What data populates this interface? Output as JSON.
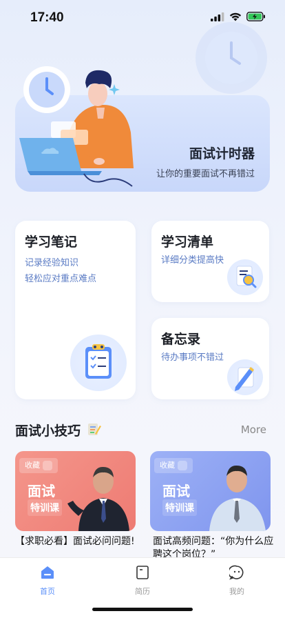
{
  "status_bar": {
    "time": "17:40"
  },
  "hero": {
    "title": "面试计时器",
    "subtitle": "让你的重要面试不再错过"
  },
  "cards": {
    "notes": {
      "title": "学习笔记",
      "line1": "记录经验知识",
      "line2": "轻松应对重点难点"
    },
    "checklist": {
      "title": "学习清单",
      "subtitle": "详细分类提高快"
    },
    "memo": {
      "title": "备忘录",
      "subtitle": "待办事项不错过"
    }
  },
  "tips": {
    "title": "面试小技巧",
    "more_label": "More",
    "videos": [
      {
        "badge": "收藏",
        "overlay_line1": "面试",
        "overlay_line2": "特训课",
        "caption": "【求职必看】面试必问问题!"
      },
      {
        "badge": "收藏",
        "overlay_line1": "面试",
        "overlay_line2": "特训课",
        "caption": "面试高频问题：“你为什么应聘这个岗位？”"
      }
    ]
  },
  "tabbar": {
    "items": [
      {
        "label": "首页",
        "icon": "home-icon",
        "active": true
      },
      {
        "label": "简历",
        "icon": "resume-icon",
        "active": false
      },
      {
        "label": "我的",
        "icon": "profile-icon",
        "active": false
      }
    ]
  },
  "colors": {
    "accent": "#5b8ff9",
    "card_sub": "#5a7bc4",
    "video_red": "#f0847a",
    "video_blue": "#8fa3f2"
  }
}
